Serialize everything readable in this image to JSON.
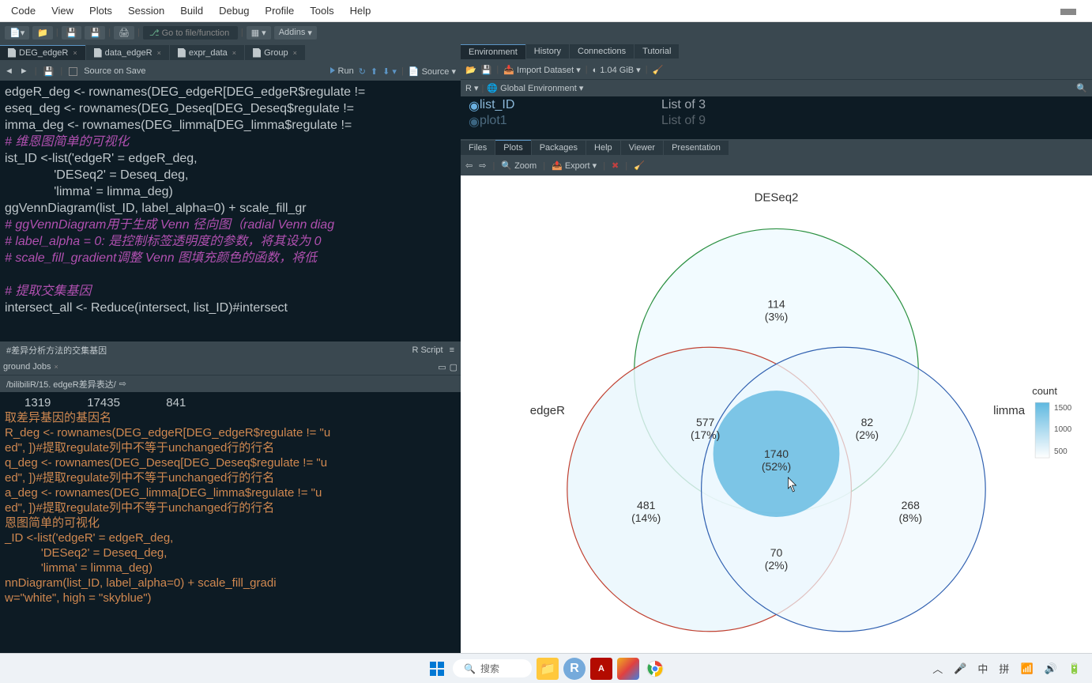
{
  "menu": {
    "items": [
      "Code",
      "View",
      "Plots",
      "Session",
      "Build",
      "Debug",
      "Profile",
      "Tools",
      "Help"
    ]
  },
  "toolbar": {
    "goto": "Go to file/function",
    "addins": "Addins"
  },
  "editor_tabs": [
    {
      "label": "DEG_edgeR",
      "active": true
    },
    {
      "label": "data_edgeR",
      "active": false
    },
    {
      "label": "expr_data",
      "active": false
    },
    {
      "label": "Group",
      "active": false
    }
  ],
  "filebar": {
    "source_on_save": "Source on Save",
    "run": "Run",
    "source": "Source"
  },
  "code": {
    "l1": "edgeR_deg <- rownames(DEG_edgeR[DEG_edgeR$regulate !=",
    "l2": "eseq_deg <- rownames(DEG_Deseq[DEG_Deseq$regulate !=",
    "l3": "imma_deg <- rownames(DEG_limma[DEG_limma$regulate !=",
    "l4": "# 维恩图简单的可视化",
    "l5": "ist_ID <-list('edgeR' = edgeR_deg,",
    "l6": "              'DESeq2' = Deseq_deg,",
    "l7": "              'limma' = limma_deg)",
    "l8": "ggVennDiagram(list_ID, label_alpha=0) + scale_fill_gr",
    "l9": "# ggVennDiagram用于生成 Venn 径向图（radial Venn diag",
    "l10": "# label_alpha = 0: 是控制标签透明度的参数，将其设为 0",
    "l11": "# scale_fill_gradient调整 Venn 图填充颜色的函数，将低",
    "l12": "",
    "l13": "# 提取交集基因",
    "l14": "intersect_all <- Reduce(intersect, list_ID)#intersect"
  },
  "status": {
    "left": "#差异分析方法的交集基因",
    "right": "R Script"
  },
  "console_tab": "ground Jobs",
  "console_path": "/bilibiliR/15. edgeR差异表达/",
  "console": {
    "l0": "      1319           17435              841",
    "l1": "取差异基因的基因名",
    "l2": "R_deg <- rownames(DEG_edgeR[DEG_edgeR$regulate != \"u",
    "l3": "ed\", ])#提取regulate列中不等于unchanged行的行名",
    "l4": "q_deg <- rownames(DEG_Deseq[DEG_Deseq$regulate != \"u",
    "l5": "ed\", ])#提取regulate列中不等于unchanged行的行名",
    "l6": "a_deg <- rownames(DEG_limma[DEG_limma$regulate != \"u",
    "l7": "ed\", ])#提取regulate列中不等于unchanged行的行名",
    "l8": "恩图简单的可视化",
    "l9": "_ID <-list('edgeR' = edgeR_deg,",
    "l10": "           'DESeq2' = Deseq_deg,",
    "l11": "           'limma' = limma_deg)",
    "l12": "nnDiagram(list_ID, label_alpha=0) + scale_fill_gradi",
    "l13": "w=\"white\", high = \"skyblue\")"
  },
  "env_tabs": [
    "Environment",
    "History",
    "Connections",
    "Tutorial"
  ],
  "env_toolbar": {
    "import": "Import Dataset",
    "mem": "1.04 GiB"
  },
  "env_scope": {
    "r": "R",
    "global": "Global Environment"
  },
  "env_items": [
    {
      "name": "list_ID",
      "val": "List of  3"
    },
    {
      "name": "plot1",
      "val": "List of  9"
    }
  ],
  "plot_tabs": [
    "Files",
    "Plots",
    "Packages",
    "Help",
    "Viewer",
    "Presentation"
  ],
  "plot_toolbar": {
    "zoom": "Zoom",
    "export": "Export"
  },
  "venn": {
    "title_deseq": "DESeq2",
    "title_edger": "edgeR",
    "title_limma": "limma",
    "r_deseq": {
      "n": "114",
      "p": "(3%)"
    },
    "r_edger": {
      "n": "481",
      "p": "(14%)"
    },
    "r_limma": {
      "n": "268",
      "p": "(8%)"
    },
    "r_de": {
      "n": "577",
      "p": "(17%)"
    },
    "r_dl": {
      "n": "82",
      "p": "(2%)"
    },
    "r_el": {
      "n": "70",
      "p": "(2%)"
    },
    "r_all": {
      "n": "1740",
      "p": "(52%)"
    },
    "legend": {
      "title": "count",
      "v1": "1500",
      "v2": "1000",
      "v3": "500"
    }
  },
  "taskbar": {
    "search": "搜索",
    "ime1": "中",
    "ime2": "拼"
  },
  "chart_data": {
    "type": "venn",
    "sets": [
      "DESeq2",
      "edgeR",
      "limma"
    ],
    "regions": {
      "DESeq2_only": {
        "count": 114,
        "percent": 3
      },
      "edgeR_only": {
        "count": 481,
        "percent": 14
      },
      "limma_only": {
        "count": 268,
        "percent": 8
      },
      "DESeq2_edgeR": {
        "count": 577,
        "percent": 17
      },
      "DESeq2_limma": {
        "count": 82,
        "percent": 2
      },
      "edgeR_limma": {
        "count": 70,
        "percent": 2
      },
      "all": {
        "count": 1740,
        "percent": 52
      }
    },
    "fill_legend": {
      "label": "count",
      "ticks": [
        500,
        1000,
        1500
      ]
    }
  }
}
